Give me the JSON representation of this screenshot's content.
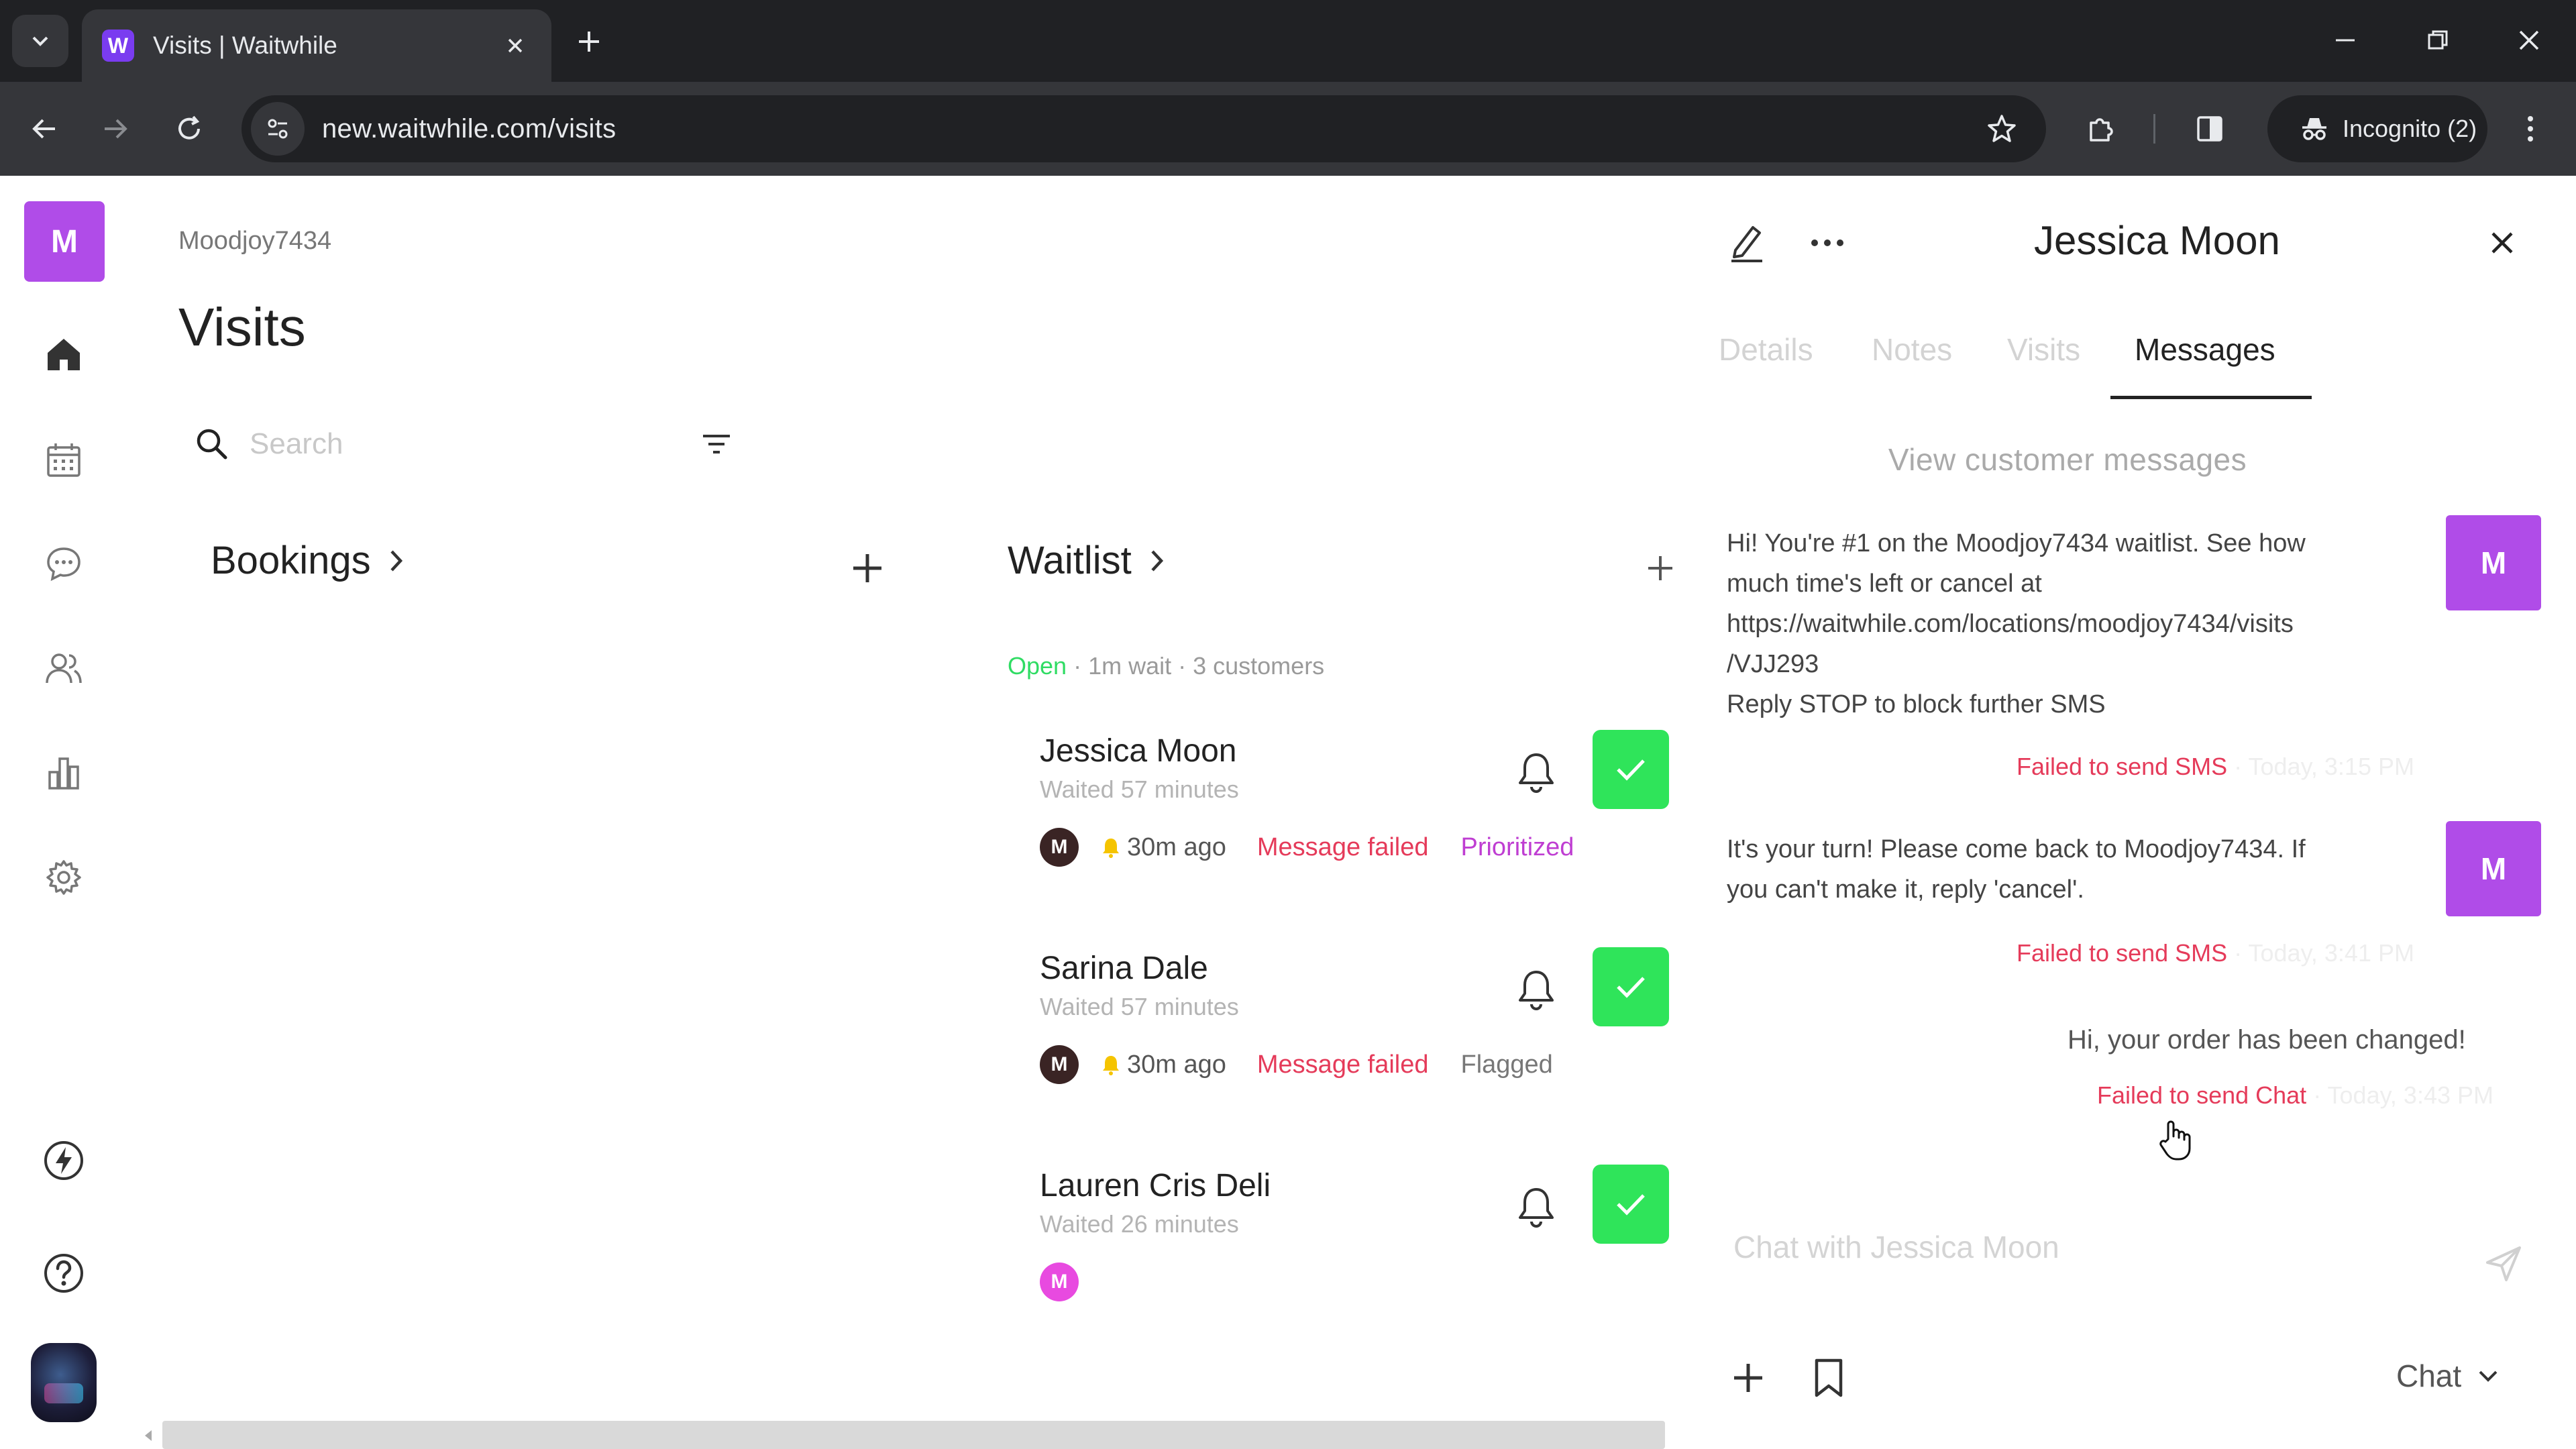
{
  "browser": {
    "tab_title": "Visits | Waitwhile",
    "favicon_letter": "W",
    "url": "new.waitwhile.com/visits",
    "incognito_label": "Incognito (2)"
  },
  "sidebar": {
    "logo_letter": "M",
    "items": [
      {
        "name": "home-icon"
      },
      {
        "name": "calendar-icon"
      },
      {
        "name": "chat-bubble-icon"
      },
      {
        "name": "customers-icon"
      },
      {
        "name": "analytics-icon"
      },
      {
        "name": "settings-gear-icon"
      },
      {
        "name": "bolt-icon"
      },
      {
        "name": "help-icon"
      }
    ]
  },
  "main": {
    "org_name": "Moodjoy7434",
    "title": "Visits",
    "search_placeholder": "Search",
    "bookings_label": "Bookings",
    "waitlist_label": "Waitlist",
    "waitlist_status": {
      "open": "Open",
      "separator": " · ",
      "wait": "1m wait",
      "customers": "3 customers"
    },
    "visitors": [
      {
        "name": "Jessica Moon",
        "waited": "Waited 57 minutes",
        "avatar": "M",
        "ago": "30m ago",
        "message": "Message failed",
        "tag": "Prioritized"
      },
      {
        "name": "Sarina Dale",
        "waited": "Waited 57 minutes",
        "avatar": "M",
        "ago": "30m ago",
        "message": "Message failed",
        "tag": "Flagged"
      },
      {
        "name": "Lauren Cris Deli",
        "waited": "Waited 26 minutes",
        "avatar": "M"
      }
    ]
  },
  "panel": {
    "customer_name": "Jessica Moon",
    "tabs": [
      "Details",
      "Notes",
      "Visits",
      "Messages"
    ],
    "active_tab": "Messages",
    "subheading": "View customer messages",
    "messages": [
      {
        "lines": [
          "Hi! You're #1 on the Moodjoy7434 waitlist. See how",
          "much time's left or cancel at",
          "https://waitwhile.com/locations/moodjoy7434/visits",
          "/VJJ293",
          "Reply STOP to block further SMS"
        ],
        "status": "Failed to send SMS",
        "time": "Today, 3:15 PM",
        "avatar": "M"
      },
      {
        "lines": [
          "It's your turn! Please come back to Moodjoy7434. If",
          "you can't make it, reply 'cancel'."
        ],
        "status": "Failed to send SMS",
        "time": "Today, 3:41 PM",
        "avatar": "M"
      },
      {
        "text": "Hi, your order has been changed!",
        "status": "Failed to send Chat",
        "time": "Today, 3:43 PM"
      }
    ],
    "compose_placeholder": "Chat with Jessica Moon",
    "channel": "Chat"
  }
}
